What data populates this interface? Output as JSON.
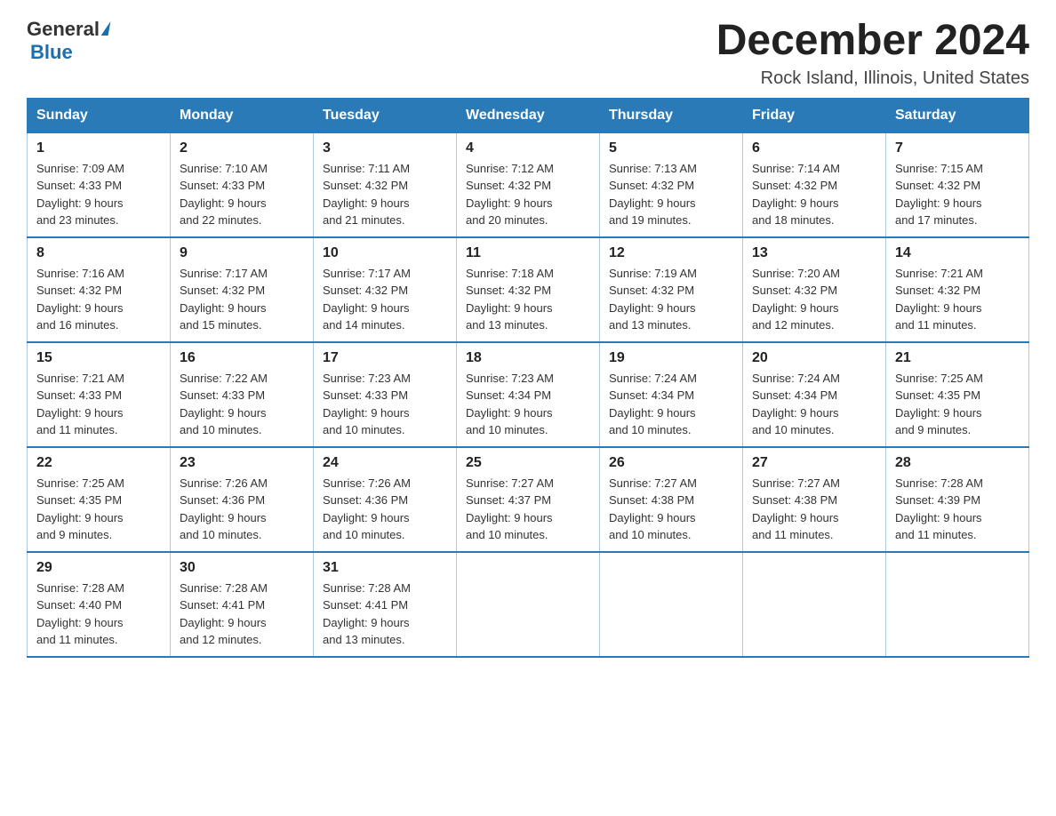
{
  "header": {
    "logo": {
      "general": "General",
      "arrow": "▶",
      "blue": "Blue"
    },
    "title": "December 2024",
    "subtitle": "Rock Island, Illinois, United States"
  },
  "days_of_week": [
    "Sunday",
    "Monday",
    "Tuesday",
    "Wednesday",
    "Thursday",
    "Friday",
    "Saturday"
  ],
  "weeks": [
    [
      {
        "day": "1",
        "sunrise": "7:09 AM",
        "sunset": "4:33 PM",
        "daylight": "9 hours and 23 minutes."
      },
      {
        "day": "2",
        "sunrise": "7:10 AM",
        "sunset": "4:33 PM",
        "daylight": "9 hours and 22 minutes."
      },
      {
        "day": "3",
        "sunrise": "7:11 AM",
        "sunset": "4:32 PM",
        "daylight": "9 hours and 21 minutes."
      },
      {
        "day": "4",
        "sunrise": "7:12 AM",
        "sunset": "4:32 PM",
        "daylight": "9 hours and 20 minutes."
      },
      {
        "day": "5",
        "sunrise": "7:13 AM",
        "sunset": "4:32 PM",
        "daylight": "9 hours and 19 minutes."
      },
      {
        "day": "6",
        "sunrise": "7:14 AM",
        "sunset": "4:32 PM",
        "daylight": "9 hours and 18 minutes."
      },
      {
        "day": "7",
        "sunrise": "7:15 AM",
        "sunset": "4:32 PM",
        "daylight": "9 hours and 17 minutes."
      }
    ],
    [
      {
        "day": "8",
        "sunrise": "7:16 AM",
        "sunset": "4:32 PM",
        "daylight": "9 hours and 16 minutes."
      },
      {
        "day": "9",
        "sunrise": "7:17 AM",
        "sunset": "4:32 PM",
        "daylight": "9 hours and 15 minutes."
      },
      {
        "day": "10",
        "sunrise": "7:17 AM",
        "sunset": "4:32 PM",
        "daylight": "9 hours and 14 minutes."
      },
      {
        "day": "11",
        "sunrise": "7:18 AM",
        "sunset": "4:32 PM",
        "daylight": "9 hours and 13 minutes."
      },
      {
        "day": "12",
        "sunrise": "7:19 AM",
        "sunset": "4:32 PM",
        "daylight": "9 hours and 13 minutes."
      },
      {
        "day": "13",
        "sunrise": "7:20 AM",
        "sunset": "4:32 PM",
        "daylight": "9 hours and 12 minutes."
      },
      {
        "day": "14",
        "sunrise": "7:21 AM",
        "sunset": "4:32 PM",
        "daylight": "9 hours and 11 minutes."
      }
    ],
    [
      {
        "day": "15",
        "sunrise": "7:21 AM",
        "sunset": "4:33 PM",
        "daylight": "9 hours and 11 minutes."
      },
      {
        "day": "16",
        "sunrise": "7:22 AM",
        "sunset": "4:33 PM",
        "daylight": "9 hours and 10 minutes."
      },
      {
        "day": "17",
        "sunrise": "7:23 AM",
        "sunset": "4:33 PM",
        "daylight": "9 hours and 10 minutes."
      },
      {
        "day": "18",
        "sunrise": "7:23 AM",
        "sunset": "4:34 PM",
        "daylight": "9 hours and 10 minutes."
      },
      {
        "day": "19",
        "sunrise": "7:24 AM",
        "sunset": "4:34 PM",
        "daylight": "9 hours and 10 minutes."
      },
      {
        "day": "20",
        "sunrise": "7:24 AM",
        "sunset": "4:34 PM",
        "daylight": "9 hours and 10 minutes."
      },
      {
        "day": "21",
        "sunrise": "7:25 AM",
        "sunset": "4:35 PM",
        "daylight": "9 hours and 9 minutes."
      }
    ],
    [
      {
        "day": "22",
        "sunrise": "7:25 AM",
        "sunset": "4:35 PM",
        "daylight": "9 hours and 9 minutes."
      },
      {
        "day": "23",
        "sunrise": "7:26 AM",
        "sunset": "4:36 PM",
        "daylight": "9 hours and 10 minutes."
      },
      {
        "day": "24",
        "sunrise": "7:26 AM",
        "sunset": "4:36 PM",
        "daylight": "9 hours and 10 minutes."
      },
      {
        "day": "25",
        "sunrise": "7:27 AM",
        "sunset": "4:37 PM",
        "daylight": "9 hours and 10 minutes."
      },
      {
        "day": "26",
        "sunrise": "7:27 AM",
        "sunset": "4:38 PM",
        "daylight": "9 hours and 10 minutes."
      },
      {
        "day": "27",
        "sunrise": "7:27 AM",
        "sunset": "4:38 PM",
        "daylight": "9 hours and 11 minutes."
      },
      {
        "day": "28",
        "sunrise": "7:28 AM",
        "sunset": "4:39 PM",
        "daylight": "9 hours and 11 minutes."
      }
    ],
    [
      {
        "day": "29",
        "sunrise": "7:28 AM",
        "sunset": "4:40 PM",
        "daylight": "9 hours and 11 minutes."
      },
      {
        "day": "30",
        "sunrise": "7:28 AM",
        "sunset": "4:41 PM",
        "daylight": "9 hours and 12 minutes."
      },
      {
        "day": "31",
        "sunrise": "7:28 AM",
        "sunset": "4:41 PM",
        "daylight": "9 hours and 13 minutes."
      },
      null,
      null,
      null,
      null
    ]
  ]
}
